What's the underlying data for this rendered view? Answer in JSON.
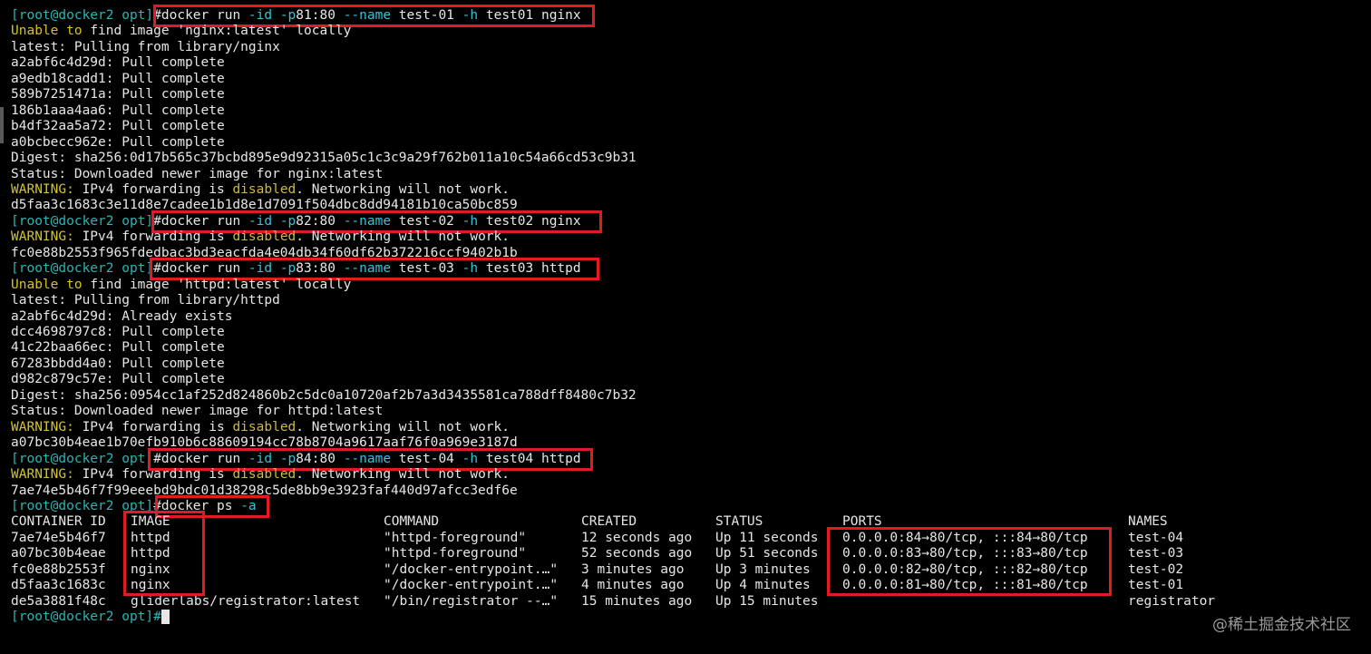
{
  "prompt": {
    "user_host": "[root@docker2 opt]",
    "symbol": "#"
  },
  "lines": [
    {
      "type": "cmd",
      "parts": [
        [
          "g",
          "docker run "
        ],
        [
          "c",
          "-id -p"
        ],
        [
          "g",
          "81:80 "
        ],
        [
          "c",
          "--name"
        ],
        [
          "g",
          " test-01 "
        ],
        [
          "c",
          "-h"
        ],
        [
          "g",
          " test01 nginx"
        ]
      ]
    },
    {
      "type": "text",
      "parts": [
        [
          "y",
          "Unable to"
        ],
        [
          "g",
          " find image 'nginx:latest' locally"
        ]
      ]
    },
    {
      "type": "text",
      "parts": [
        [
          "g",
          "latest: Pulling from library/nginx"
        ]
      ]
    },
    {
      "type": "text",
      "parts": [
        [
          "g",
          "a2abf6c4d29d: Pull complete"
        ]
      ]
    },
    {
      "type": "text",
      "parts": [
        [
          "g",
          "a9edb18cadd1: Pull complete"
        ]
      ]
    },
    {
      "type": "text",
      "parts": [
        [
          "g",
          "589b7251471a: Pull complete"
        ]
      ]
    },
    {
      "type": "text",
      "parts": [
        [
          "g",
          "186b1aaa4aa6: Pull complete"
        ]
      ]
    },
    {
      "type": "text",
      "parts": [
        [
          "g",
          "b4df32aa5a72: Pull complete"
        ]
      ]
    },
    {
      "type": "text",
      "parts": [
        [
          "g",
          "a0bcbecc962e: Pull complete"
        ]
      ]
    },
    {
      "type": "text",
      "parts": [
        [
          "g",
          "Digest: sha256:0d17b565c37bcbd895e9d92315a05c1c3c9a29f762b011a10c54a66cd53c9b31"
        ]
      ]
    },
    {
      "type": "text",
      "parts": [
        [
          "g",
          "Status: Downloaded newer image for nginx:latest"
        ]
      ]
    },
    {
      "type": "text",
      "parts": [
        [
          "y",
          "WARNING:"
        ],
        [
          "g",
          " IPv4 forwarding is "
        ],
        [
          "o",
          "disabled"
        ],
        [
          "g",
          ". Networking will not work."
        ]
      ]
    },
    {
      "type": "text",
      "parts": [
        [
          "g",
          "d5faa3c1683c3e11d8e7cadee1b1d8e1d7091f504dbc8dd94181b10ca50bc859"
        ]
      ]
    },
    {
      "type": "cmd",
      "parts": [
        [
          "g",
          "docker run "
        ],
        [
          "c",
          "-id -p"
        ],
        [
          "g",
          "82:80 "
        ],
        [
          "c",
          "--name"
        ],
        [
          "g",
          " test-02 "
        ],
        [
          "c",
          "-h"
        ],
        [
          "g",
          " test02 nginx"
        ]
      ]
    },
    {
      "type": "text",
      "parts": [
        [
          "y",
          "WARNING:"
        ],
        [
          "g",
          " IPv4 forwarding is "
        ],
        [
          "o",
          "disabled"
        ],
        [
          "g",
          ". Networking will not work."
        ]
      ]
    },
    {
      "type": "text",
      "parts": [
        [
          "g",
          "fc0e88b2553f965fdedbac3bd3eacfda4e04db34f60df62b372216ccf9402b1b"
        ]
      ]
    },
    {
      "type": "cmd",
      "parts": [
        [
          "g",
          "docker run "
        ],
        [
          "c",
          "-id -p"
        ],
        [
          "g",
          "83:80 "
        ],
        [
          "c",
          "--name"
        ],
        [
          "g",
          " test-03 "
        ],
        [
          "c",
          "-h"
        ],
        [
          "g",
          " test03 httpd"
        ]
      ]
    },
    {
      "type": "text",
      "parts": [
        [
          "y",
          "Unable to"
        ],
        [
          "g",
          " find image 'httpd:latest' locally"
        ]
      ]
    },
    {
      "type": "text",
      "parts": [
        [
          "g",
          "latest: Pulling from library/httpd"
        ]
      ]
    },
    {
      "type": "text",
      "parts": [
        [
          "g",
          "a2abf6c4d29d: Already exists"
        ]
      ]
    },
    {
      "type": "text",
      "parts": [
        [
          "g",
          "dcc4698797c8: Pull complete"
        ]
      ]
    },
    {
      "type": "text",
      "parts": [
        [
          "g",
          "41c22baa66ec: Pull complete"
        ]
      ]
    },
    {
      "type": "text",
      "parts": [
        [
          "g",
          "67283bbdd4a0: Pull complete"
        ]
      ]
    },
    {
      "type": "text",
      "parts": [
        [
          "g",
          "d982c879c57e: Pull complete"
        ]
      ]
    },
    {
      "type": "text",
      "parts": [
        [
          "g",
          "Digest: sha256:0954cc1af252d824860b2c5dc0a10720af2b7a3d3435581ca788dff8480c7b32"
        ]
      ]
    },
    {
      "type": "text",
      "parts": [
        [
          "g",
          "Status: Downloaded newer image for httpd:latest"
        ]
      ]
    },
    {
      "type": "text",
      "parts": [
        [
          "y",
          "WARNING:"
        ],
        [
          "g",
          " IPv4 forwarding is "
        ],
        [
          "o",
          "disabled"
        ],
        [
          "g",
          ". Networking will not work."
        ]
      ]
    },
    {
      "type": "text",
      "parts": [
        [
          "g",
          "a07bc30b4eae1b70efb910b6c88609194cc78b8704a9617aaf76f0a969e3187d"
        ]
      ]
    },
    {
      "type": "cmd",
      "parts": [
        [
          "g",
          "docker run "
        ],
        [
          "c",
          "-id -p"
        ],
        [
          "g",
          "84:80 "
        ],
        [
          "c",
          "--name"
        ],
        [
          "g",
          " test-04 "
        ],
        [
          "c",
          "-h"
        ],
        [
          "g",
          " test04 httpd"
        ]
      ]
    },
    {
      "type": "text",
      "parts": [
        [
          "y",
          "WARNING:"
        ],
        [
          "g",
          " IPv4 forwarding is "
        ],
        [
          "o",
          "disabled"
        ],
        [
          "g",
          ". Networking will not work."
        ]
      ]
    },
    {
      "type": "text",
      "parts": [
        [
          "g",
          "7ae74e5b46f7f99eeebd9bdc01d38298c5de8bb9e3923faf440d97afcc3edf6e"
        ]
      ]
    },
    {
      "type": "cmd",
      "parts": [
        [
          "g",
          "docker ps "
        ],
        [
          "c",
          "-a"
        ]
      ]
    }
  ],
  "table": {
    "headers": [
      "CONTAINER ID",
      "IMAGE",
      "COMMAND",
      "CREATED",
      "STATUS",
      "PORTS",
      "NAMES"
    ],
    "rows": [
      [
        "7ae74e5b46f7",
        "httpd",
        "\"httpd-foreground\"",
        "12 seconds ago",
        "Up 11 seconds",
        "0.0.0.0:84→80/tcp, :::84→80/tcp",
        "test-04"
      ],
      [
        "a07bc30b4eae",
        "httpd",
        "\"httpd-foreground\"",
        "52 seconds ago",
        "Up 51 seconds",
        "0.0.0.0:83→80/tcp, :::83→80/tcp",
        "test-03"
      ],
      [
        "fc0e88b2553f",
        "nginx",
        "\"/docker-entrypoint.…\"",
        "3 minutes ago",
        "Up 3 minutes",
        "0.0.0.0:82→80/tcp, :::82→80/tcp",
        "test-02"
      ],
      [
        "d5faa3c1683c",
        "nginx",
        "\"/docker-entrypoint.…\"",
        "4 minutes ago",
        "Up 4 minutes",
        "0.0.0.0:81→80/tcp, :::81→80/tcp",
        "test-01"
      ],
      [
        "de5a3881f48c",
        "gliderlabs/registrator:latest",
        "\"/bin/registrator --…\"",
        "15 minutes ago",
        "Up 15 minutes",
        "",
        "registrator"
      ]
    ]
  },
  "final_prompt": "[root@docker2 opt]#",
  "watermark": "@稀土掘金技术社区",
  "colors": {
    "highlight_box": "#e01b24",
    "prompt": "#2ab5b3",
    "option_flag": "#36c3d7",
    "warning": "#d4c423"
  }
}
